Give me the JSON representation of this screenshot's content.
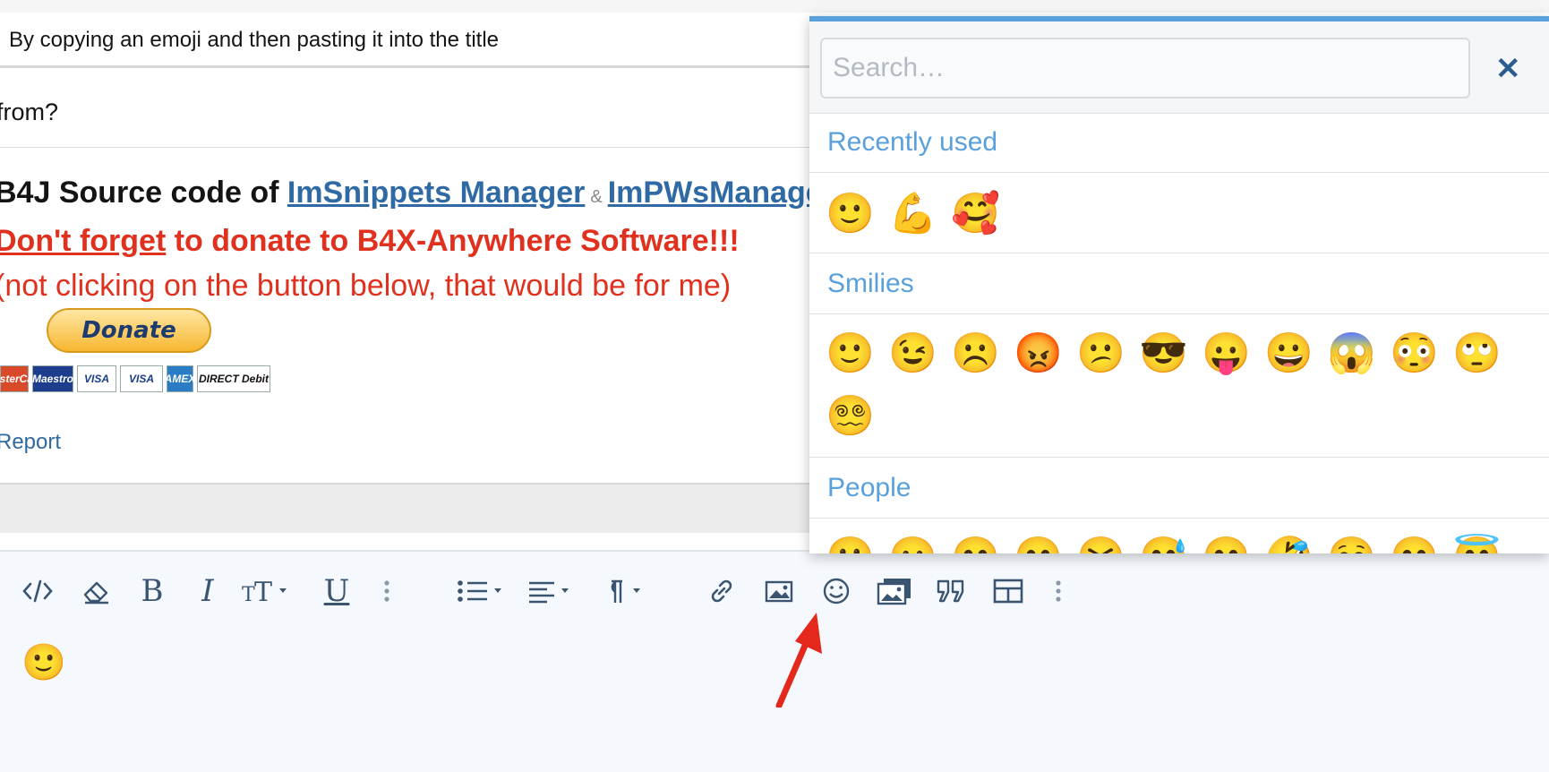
{
  "post": {
    "title_hint": "By copying an emoji and then pasting it into the title",
    "question_fragment": "from?",
    "signature": {
      "prefix": "B4J Source code of",
      "link1": "ImSnippets Manager",
      "amp": "&",
      "link2": "ImPWsManager",
      "line2_underlined": "Don't forget",
      "line2_rest": " to donate to B4X-Anywhere Software!!!",
      "line3": "(not clicking on the button below, that would be for me)",
      "donate_label": "Donate",
      "cards": [
        "MasterCard",
        "Maestro",
        "VISA",
        "VISA",
        "AMEX",
        "DIRECT Debit"
      ]
    },
    "report_link": "Report"
  },
  "editor": {
    "content_emoji": "🙂",
    "toolbar_icons": [
      "code-icon",
      "eraser-icon",
      "bold-icon",
      "italic-icon",
      "text-size-icon",
      "underline-icon",
      "more-icon",
      "list-icon",
      "align-icon",
      "paragraph-icon",
      "link-icon",
      "image-icon",
      "smiley-icon",
      "media-icon",
      "quote-icon",
      "table-icon",
      "more-icon"
    ],
    "bold_glyph": "B",
    "italic_glyph": "I",
    "underline_glyph": "U"
  },
  "picker": {
    "search_placeholder": "Search…",
    "close_glyph": "✕",
    "sections": [
      {
        "title": "Recently used",
        "emojis": [
          "🙂",
          "💪",
          "🥰"
        ]
      },
      {
        "title": "Smilies",
        "emojis": [
          "🙂",
          "😉",
          "☹️",
          "😡",
          "😕",
          "😎",
          "😛",
          "😀",
          "😱",
          "😳",
          "🙄",
          "😵‍💫"
        ]
      },
      {
        "title": "People",
        "emojis": [
          "🙂",
          "😐",
          "😊",
          "😄",
          "😆",
          "😅",
          "😁",
          "🤣",
          "☺️",
          "😊",
          "😇"
        ]
      }
    ]
  },
  "colors": {
    "accent": "#5aa0dc",
    "link": "#2f6aa4",
    "red": "#e0301e"
  }
}
